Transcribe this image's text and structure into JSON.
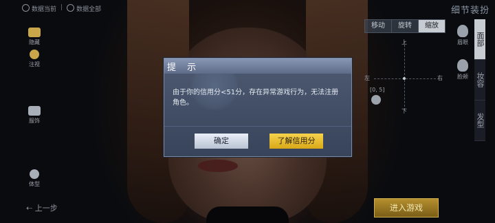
{
  "top_toolbar": {
    "left_label": "数据当前",
    "right_label": "数据全部"
  },
  "left_sidebar": [
    {
      "label": "隐藏",
      "icon": "hide-icon"
    },
    {
      "label": "注视",
      "icon": "eye-icon"
    },
    {
      "label": "服饰",
      "icon": "clothing-icon"
    },
    {
      "label": "体型",
      "icon": "body-icon"
    }
  ],
  "back_step": "上一步",
  "right_panel": {
    "title": "细节装扮",
    "mode_tabs": [
      "移动",
      "旋转",
      "缩放"
    ],
    "active_mode": "缩放",
    "joystick": {
      "up": "上",
      "down": "下",
      "left": "左",
      "right": "右",
      "readout": "[0, 5]"
    },
    "face_parts": [
      "眉眼",
      "脸颊"
    ],
    "side_tabs": [
      "面部",
      "妆容",
      "发型"
    ],
    "active_side_tab": "面部",
    "enter_button": "进入游戏"
  },
  "dialog": {
    "title": "提 示",
    "message": "由于你的信用分<51分，存在异常游戏行为，无法注册角色。",
    "ok_label": "确定",
    "credit_label": "了解信用分"
  },
  "colors": {
    "accent_gold": "#d9a818",
    "dialog_bg": "#4d5a72"
  }
}
